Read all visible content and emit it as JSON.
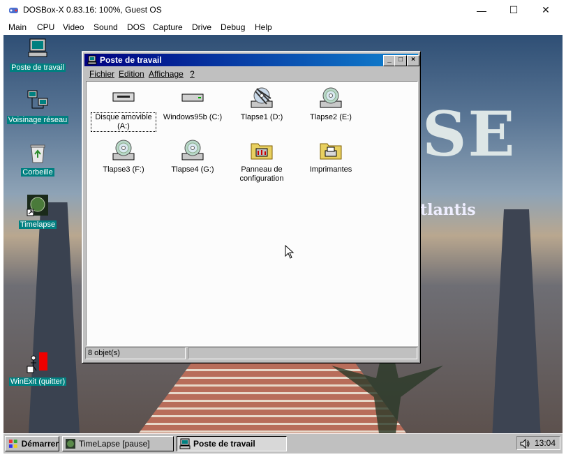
{
  "host": {
    "title": "DOSBox-X 0.83.16: 100%, Guest OS",
    "controls": {
      "minimize": "—",
      "maximize": "☐",
      "close": "✕"
    },
    "menu": [
      "Main",
      "CPU",
      "Video",
      "Sound",
      "DOS",
      "Capture",
      "Drive",
      "Debug",
      "Help"
    ]
  },
  "wallpaper": {
    "big_text": "SE",
    "sub_text": "tlantis"
  },
  "desktop_icons": [
    {
      "label": "Poste de travail",
      "icon": "computer-icon"
    },
    {
      "label": "Voisinage réseau",
      "icon": "network-icon"
    },
    {
      "label": "Corbeille",
      "icon": "recycle-bin-icon"
    },
    {
      "label": "Timelapse",
      "icon": "timelapse-shortcut-icon"
    },
    {
      "label": "WinExit (quitter)",
      "icon": "winexit-shortcut-icon"
    }
  ],
  "window": {
    "title": "Poste de travail",
    "menu": [
      "Fichier",
      "Edition",
      "Affichage",
      "?"
    ],
    "items": [
      {
        "label": "Disque amovible (A:)",
        "icon": "floppy-drive-icon",
        "selected": true
      },
      {
        "label": "Windows95b (C:)",
        "icon": "hard-drive-icon"
      },
      {
        "label": "Tlapse1 (D:)",
        "icon": "cdrom-drive-icon"
      },
      {
        "label": "Tlapse2 (E:)",
        "icon": "cdrom-drive-icon"
      },
      {
        "label": "Tlapse3 (F:)",
        "icon": "cdrom-drive-icon"
      },
      {
        "label": "Tlapse4 (G:)",
        "icon": "cdrom-drive-icon"
      },
      {
        "label": "Panneau de configuration",
        "icon": "control-panel-folder-icon"
      },
      {
        "label": "Imprimantes",
        "icon": "printers-folder-icon"
      }
    ],
    "status": "8 objet(s)"
  },
  "taskbar": {
    "start_label": "Démarrer",
    "tasks": [
      {
        "label": "TimeLapse [pause]",
        "active": false
      },
      {
        "label": "Poste de travail",
        "active": true
      }
    ],
    "clock": "13:04"
  },
  "colors": {
    "title_bar": "#000080",
    "desktop_label_bg": "#008080",
    "window_face": "#c0c0c0"
  }
}
